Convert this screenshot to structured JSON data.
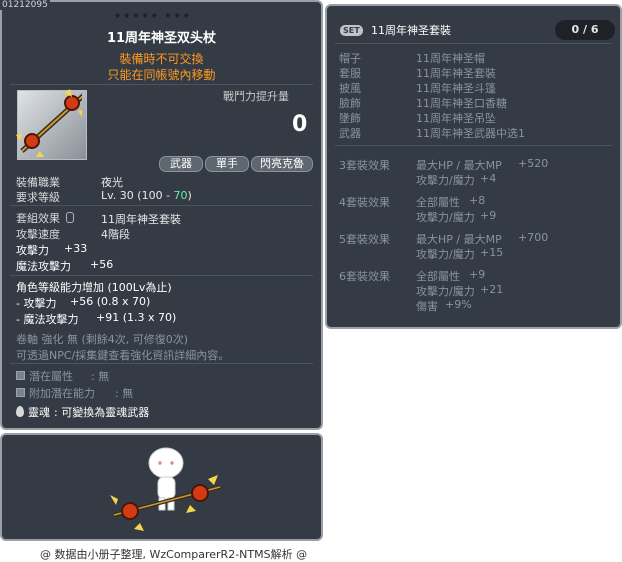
{
  "item_id": "01212095",
  "stars": "★★★★★  ★★★",
  "item": {
    "name": "11周年神圣双头杖",
    "warn1": "裝備時不可交換",
    "warn2": "只能在同帳號內移動",
    "power_label": "戰鬥力提升量",
    "power_value": "0",
    "tags": [
      "武器",
      "單手",
      "閃亮克魯"
    ],
    "job_label": "裝備職業",
    "job_value": "夜光",
    "level_label": "要求等級",
    "level_value": "Lv. 30",
    "level_range_a": "(100 -",
    "level_range_b": "70",
    "level_range_c": ")",
    "set_effect_label": "套組效果",
    "set_effect_value": "11周年神圣套裝",
    "speed_label": "攻擊速度",
    "speed_value": "4階段",
    "atk_label": "攻擊力",
    "atk_value": "+33",
    "matk_label": "魔法攻擊力",
    "matk_value": "+56",
    "bonus_header": "角色等級能力增加 (100Lv為止)",
    "bonus_atk_label": "- 攻擊力",
    "bonus_atk_value": "+56 (0.8 x 70)",
    "bonus_matk_label": "- 魔法攻擊力",
    "bonus_matk_value": "+91 (1.3 x 70)",
    "scroll_line": "卷軸 強化 無 (剩餘4次, 可修復0次)",
    "npc_line": "可透過NPC/採集鍵查看強化資訊詳細內容。",
    "potential_label": "潛在屬性",
    "potential_value": ": 無",
    "add_potential_label": "附加潛在能力",
    "add_potential_value": ": 無",
    "soul_label": "靈魂",
    "soul_value": ": 可變換為靈魂武器"
  },
  "set_panel": {
    "badge": "SET",
    "title": "11周年神圣套裝",
    "count": "0 / 6",
    "parts": [
      {
        "label": "帽子",
        "value": "11周年神圣帽"
      },
      {
        "label": "套服",
        "value": "11周年神圣套裝"
      },
      {
        "label": "披風",
        "value": "11周年神圣斗篷"
      },
      {
        "label": "臉飾",
        "value": "11周年神圣口香糖"
      },
      {
        "label": "墬飾",
        "value": "11周年神圣吊坠"
      },
      {
        "label": "武器",
        "value": "11周年神圣武器中选1"
      }
    ],
    "effects": [
      {
        "label": "3套裝效果",
        "lines": [
          [
            "最大HP / 最大MP",
            "+520"
          ],
          [
            "攻擊力/魔力",
            "+4"
          ]
        ]
      },
      {
        "label": "4套裝效果",
        "lines": [
          [
            "全部屬性",
            "+8"
          ],
          [
            "攻擊力/魔力",
            "+9"
          ]
        ]
      },
      {
        "label": "5套裝效果",
        "lines": [
          [
            "最大HP / 最大MP",
            "+700"
          ],
          [
            "攻擊力/魔力",
            "+15"
          ]
        ]
      },
      {
        "label": "6套裝效果",
        "lines": [
          [
            "全部屬性",
            "+9"
          ],
          [
            "攻擊力/魔力",
            "+21"
          ],
          [
            "傷害",
            "+9%"
          ]
        ]
      }
    ]
  },
  "footer": "@ 数据由小册子整理, WzComparerR2-NTMS解析 @",
  "colors": {
    "panel_bg": "#343b45",
    "border": "#99a0a7",
    "warn": "#ff9a1f",
    "level_green": "#5ef2a5"
  }
}
